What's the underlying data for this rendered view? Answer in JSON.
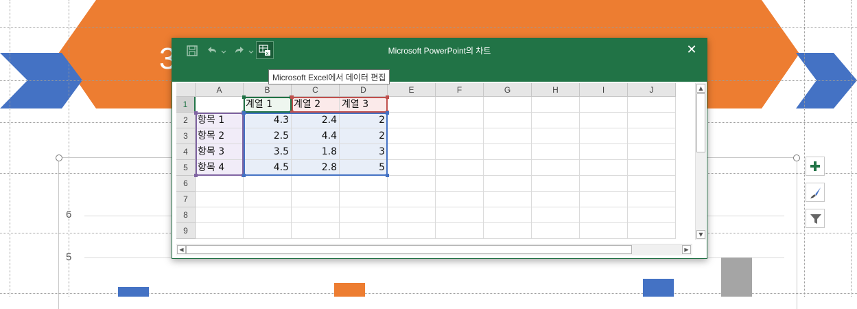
{
  "slide": {
    "title_partial": "3",
    "colors": {
      "orange": "#ED7D31",
      "blue": "#4472C4",
      "gray": "#A5A5A5"
    },
    "y_axis_ticks": [
      "6",
      "5"
    ]
  },
  "chart_tools": [
    {
      "icon": "plus-icon",
      "name": "chart-elements-button"
    },
    {
      "icon": "brush-icon",
      "name": "chart-styles-button"
    },
    {
      "icon": "filter-icon",
      "name": "chart-filters-button"
    }
  ],
  "excel_window": {
    "title": "Microsoft PowerPoint의 차트",
    "close_glyph": "✕",
    "quick_access": [
      {
        "icon": "save-icon"
      },
      {
        "icon": "undo-icon"
      },
      {
        "icon": "redo-icon"
      },
      {
        "icon": "edit-in-excel-icon"
      }
    ],
    "tooltip": "Microsoft Excel에서 데이터 편집",
    "columns": [
      "A",
      "B",
      "C",
      "D",
      "E",
      "F",
      "G",
      "H",
      "I",
      "J"
    ],
    "rows": [
      "1",
      "2",
      "3",
      "4",
      "5",
      "6",
      "7",
      "8",
      "9"
    ],
    "header_row": [
      "",
      "계열 1",
      "계열 2",
      "계열 3"
    ],
    "data_rows": [
      [
        "항목 1",
        "4.3",
        "2.4",
        "2"
      ],
      [
        "항목 2",
        "2.5",
        "4.4",
        "2"
      ],
      [
        "항목 3",
        "3.5",
        "1.8",
        "3"
      ],
      [
        "항목 4",
        "4.5",
        "2.8",
        "5"
      ]
    ]
  },
  "chart_data": {
    "type": "bar",
    "categories": [
      "항목 1",
      "항목 2",
      "항목 3",
      "항목 4"
    ],
    "series": [
      {
        "name": "계열 1",
        "values": [
          4.3,
          2.5,
          3.5,
          4.5
        ]
      },
      {
        "name": "계열 2",
        "values": [
          2.4,
          4.4,
          1.8,
          2.8
        ]
      },
      {
        "name": "계열 3",
        "values": [
          2,
          2,
          3,
          5
        ]
      }
    ],
    "ylim": [
      0,
      6
    ]
  }
}
